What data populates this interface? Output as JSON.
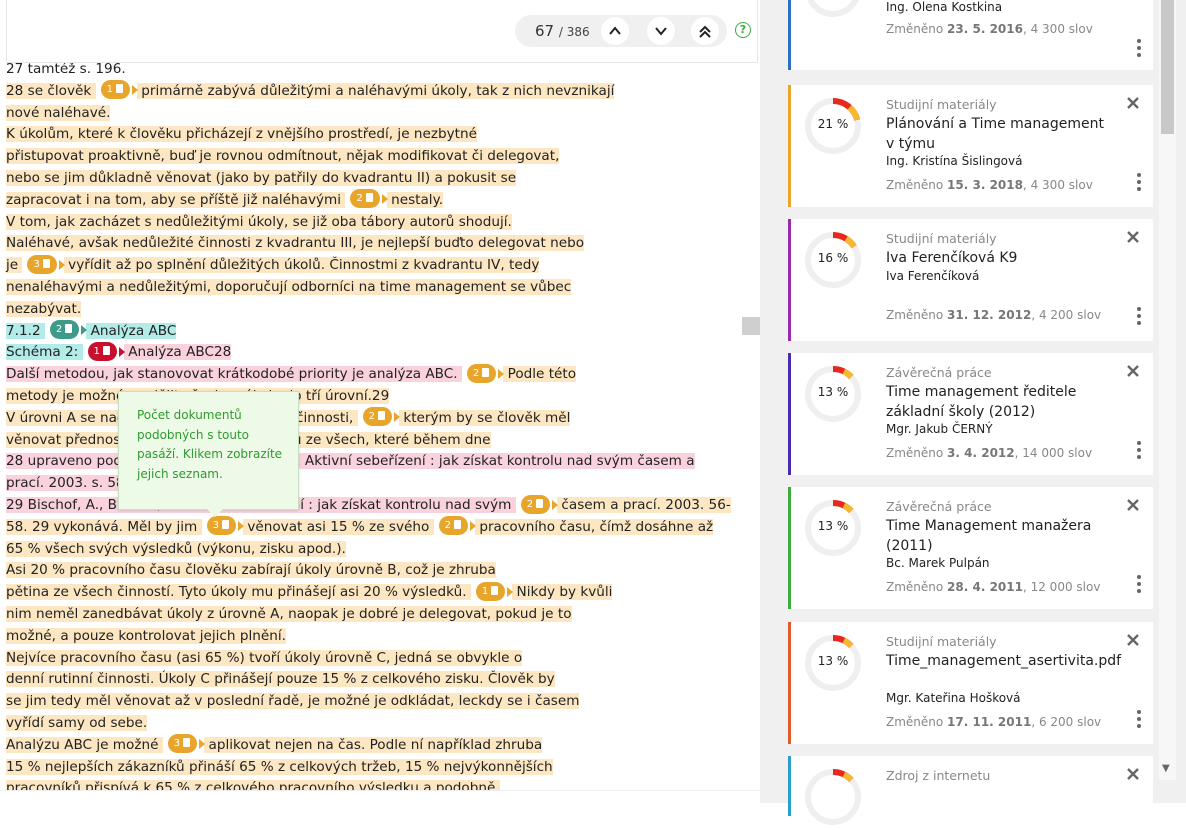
{
  "pager": {
    "current": "67",
    "total": "/ 386",
    "help": "?"
  },
  "tooltip": {
    "text": "Počet dokumentů podobných s touto pasáží. Klikem zobrazíte jejich seznam."
  },
  "doc_lines": [
    [
      {
        "t": "27 tamtéž s. 196."
      }
    ],
    [
      {
        "t": "28 se člověk ",
        "h": "y"
      },
      {
        "b": "1",
        "c": "o"
      },
      {
        "t": " primárně zabývá důležitými a naléhavými úkoly, tak z nich nevznikají",
        "h": "y"
      }
    ],
    [
      {
        "t": "nové naléhavé.",
        "h": "y"
      }
    ],
    [
      {
        "t": "K úkolům, které k člověku přicházejí z vnějšího prostředí, je nezbytné",
        "h": "y"
      }
    ],
    [
      {
        "t": "přistupovat proaktivně, buď je rovnou odmítnout, nějak modifikovat či delegovat,",
        "h": "y"
      }
    ],
    [
      {
        "t": "nebo se jim důkladně věnovat (jako by patřily do kvadrantu II) a pokusit se",
        "h": "y"
      }
    ],
    [
      {
        "t": "zapracovat i na tom, aby se příště již naléhavými ",
        "h": "y"
      },
      {
        "b": "2",
        "c": "o"
      },
      {
        "t": " nestaly.",
        "h": "y"
      }
    ],
    [
      {
        "t": "V tom, jak zacházet s nedůležitými úkoly, se již oba tábory autorů shodují.",
        "h": "y"
      }
    ],
    [
      {
        "t": "Naléhavé, avšak nedůležité činnosti z kvadrantu III, je nejlepší buďto delegovat nebo",
        "h": "y"
      }
    ],
    [
      {
        "t": "je ",
        "h": "y"
      },
      {
        "b": "3",
        "c": "o"
      },
      {
        "t": " vyřídit až po splnění důležitých úkolů. Činnostmi z kvadrantu IV, tedy",
        "h": "y"
      }
    ],
    [
      {
        "t": "nenaléhavými a nedůležitými, doporučují odborníci na time management se vůbec",
        "h": "y"
      }
    ],
    [
      {
        "t": "nezabývat.",
        "h": "y"
      }
    ],
    [
      {
        "t": "7.1.2 ",
        "h": "t"
      },
      {
        "b": "2",
        "c": "t"
      },
      {
        "t": " Analýza ABC",
        "h": "t"
      }
    ],
    [
      {
        "t": "Schéma 2: ",
        "h": "t"
      },
      {
        "b": "1",
        "c": "r"
      },
      {
        "t": " Analýza ABC28",
        "h": "p"
      }
    ],
    [
      {
        "t": "Další metodou, jak stanovovat krátkodobé priority je analýza ABC. ",
        "h": "p"
      },
      {
        "b": "2",
        "c": "o"
      },
      {
        "t": " Podle této",
        "h": "y"
      }
    ],
    [
      {
        "t": "metody je možné rozdělit všechny úkoly do tří úrovní.29",
        "h": "y"
      }
    ],
    [
      {
        "t": "V úrovni A se nachází nejdůležitější ",
        "h": "y"
      },
      {
        "b": "2",
        "c": "o"
      },
      {
        "t": " činnosti, ",
        "h": "y"
      },
      {
        "b": "2",
        "c": "o"
      },
      {
        "t": " kterým by se člověk měl",
        "h": "y"
      }
    ],
    [
      {
        "t": "věnovat přednostně. Jedná se o 15 % úkolů ze všech, které během dne",
        "h": "y"
      }
    ],
    [
      {
        "t": "28 upraveno podle BISCHOF, A., Bischof, K. Aktivní sebeřízení : jak získat kontrolu nad svým časem a",
        "h": "p"
      }
    ],
    [
      {
        "t": "prací. 2003. s. 58",
        "h": "p"
      }
    ],
    [
      {
        "t": "29 Bischof, A., Bischof, K. Aktivní sebeřízení : jak získat kontrolu nad svým ",
        "h": "p"
      },
      {
        "b": "2",
        "c": "o"
      },
      {
        "t": " časem a prací. 2003. 56-",
        "h": "y"
      }
    ],
    [
      {
        "t": "58. 29 vykonává. Měl by jim ",
        "h": "y"
      },
      {
        "b": "3",
        "c": "o"
      },
      {
        "t": " věnovat asi 15 % ze svého ",
        "h": "y"
      },
      {
        "b": "2",
        "c": "o"
      },
      {
        "t": " pracovního času, čímž dosáhne až",
        "h": "y"
      }
    ],
    [
      {
        "t": "65 % všech svých výsledků (výkonu, zisku apod.).",
        "h": "y"
      }
    ],
    [
      {
        "t": "Asi 20 % pracovního času člověku zabírají úkoly úrovně B, což je zhruba",
        "h": "y"
      }
    ],
    [
      {
        "t": "pětina ze všech činností. Tyto úkoly mu přinášejí asi 20 % výsledků. ",
        "h": "y"
      },
      {
        "b": "1",
        "c": "o"
      },
      {
        "t": " Nikdy by kvůli",
        "h": "y"
      }
    ],
    [
      {
        "t": "nim neměl zanedbávat úkoly z úrovně A, naopak je dobré je delegovat, pokud je to",
        "h": "y"
      }
    ],
    [
      {
        "t": "možné, a pouze kontrolovat jejich plnění.",
        "h": "y"
      }
    ],
    [
      {
        "t": "Nejvíce pracovního času (asi 65 %) tvoří úkoly úrovně C, jedná se obvykle o",
        "h": "y"
      }
    ],
    [
      {
        "t": "denní rutinní činnosti. Úkoly C přinášejí pouze 15 % z celkového zisku. Člověk by",
        "h": "y"
      }
    ],
    [
      {
        "t": "se jim tedy měl věnovat až v poslední řadě, je možné je odkládat, leckdy se i časem",
        "h": "y"
      }
    ],
    [
      {
        "t": "vyřídí samy od sebe.",
        "h": "y"
      }
    ],
    [
      {
        "t": "Analýzu ABC je možné ",
        "h": "y"
      },
      {
        "b": "3",
        "c": "o"
      },
      {
        "t": " aplikovat nejen na čas. Podle ní například zhruba",
        "h": "y"
      }
    ],
    [
      {
        "t": "15 % nejlepších zákazníků přináší 65 % z celkových tržeb, 15 % nejvýkonnějších",
        "h": "y"
      }
    ],
    [
      {
        "t": "pracovníků přispívá k 65 % z celkového pracovního výsledku a podobně.",
        "h": "y"
      }
    ]
  ],
  "cards": [
    {
      "type": "",
      "title": "",
      "author": "Ing. Olena Kostkina",
      "changed_prefix": "Změněno ",
      "date": "23. 5. 2016",
      "words": ", 4 300 slov",
      "percent": "",
      "value": 0.2,
      "color": "#2f6fc2"
    },
    {
      "type": "Studijní materiály",
      "title": "Plánování a Time management v týmu",
      "author": "Ing. Kristína Šislingová",
      "changed_prefix": "Změněno ",
      "date": "15. 3. 2018",
      "words": ", 4 300 slov",
      "percent": "21 %",
      "value": 0.21,
      "color": "#e8a52b"
    },
    {
      "type": "Studijní materiály",
      "title": "Iva Ferenčíková K9",
      "author": "Iva Ferenčíková",
      "changed_prefix": "Změněno ",
      "date": "31. 12. 2012",
      "words": ", 4 200 slov",
      "percent": "16 %",
      "value": 0.16,
      "color": "#9b2bb0"
    },
    {
      "type": "Závěrečná práce",
      "title": "Time management ředitele základní školy (2012)",
      "author": "Mgr. Jakub ČERNÝ",
      "changed_prefix": "Změněno ",
      "date": "3. 4. 2012",
      "words": ", 14 000 slov",
      "percent": "13 %",
      "value": 0.13,
      "color": "#4a2bb0"
    },
    {
      "type": "Závěrečná práce",
      "title": "Time Management manažera (2011)",
      "author": "Bc. Marek Pulpán",
      "changed_prefix": "Změněno ",
      "date": "28. 4. 2011",
      "words": ", 12 000 slov",
      "percent": "13 %",
      "value": 0.13,
      "color": "#3caa3c"
    },
    {
      "type": "Studijní materiály",
      "title": "Time_management_asertivita.pdf",
      "author": "Mgr. Kateřina Hošková",
      "changed_prefix": "Změněno ",
      "date": "17. 11. 2011",
      "words": ", 6 200 slov",
      "percent": "13 %",
      "value": 0.13,
      "color": "#e05a2b"
    },
    {
      "type": "Zdroj z internetu",
      "title": "",
      "author": "",
      "changed_prefix": "",
      "date": "",
      "words": "",
      "percent": "",
      "value": 0.13,
      "color": "#2aa0c8"
    }
  ]
}
